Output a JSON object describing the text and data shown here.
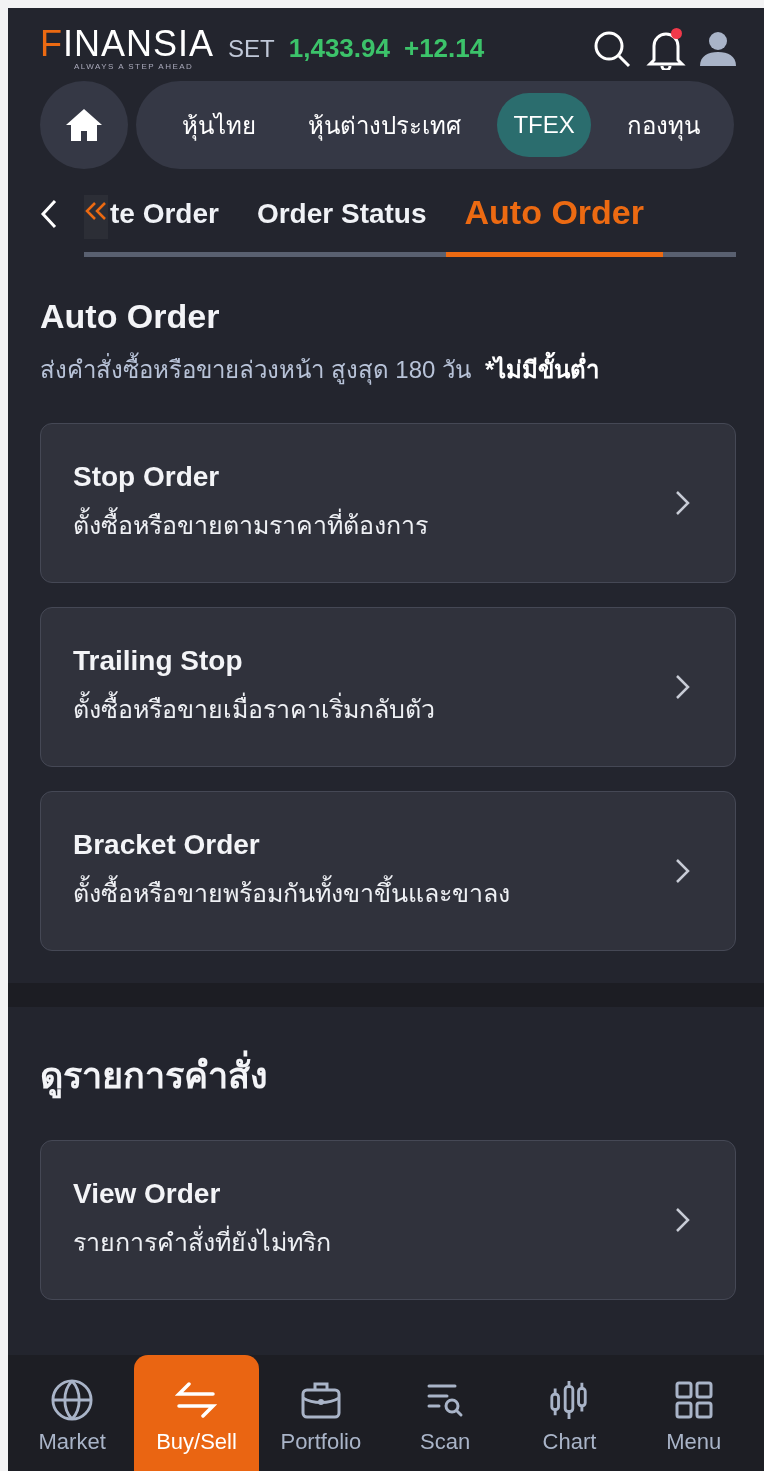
{
  "header": {
    "logo": "FINANSIA",
    "tagline": "ALWAYS A STEP AHEAD",
    "index_name": "SET",
    "index_value": "1,433.94",
    "index_change": "+12.14",
    "notification_unread": true
  },
  "market_tabs": [
    {
      "label": "หุ้นไทย",
      "selected": false
    },
    {
      "label": "หุ้นต่างประเทศ",
      "selected": false
    },
    {
      "label": "TFEX",
      "selected": true
    },
    {
      "label": "กองทุน",
      "selected": false
    }
  ],
  "order_tabs": [
    {
      "label": "te Order",
      "selected": false
    },
    {
      "label": "Order Status",
      "selected": false
    },
    {
      "label": "Auto Order",
      "selected": true
    }
  ],
  "auto_order": {
    "title": "Auto Order",
    "subtitle": "ส่งคำสั่งซื้อหรือขายล่วงหน้า สูงสุด 180 วัน",
    "note": "*ไม่มีขั้นต่ำ",
    "items": [
      {
        "title": "Stop Order",
        "description": "ตั้งซื้อหรือขายตามราคาที่ต้องการ"
      },
      {
        "title": "Trailing Stop",
        "description": "ตั้งซื้อหรือขายเมื่อราคาเริ่มกลับตัว"
      },
      {
        "title": "Bracket Order",
        "description": "ตั้งซื้อหรือขายพร้อมกันทั้งขาขึ้นและขาลง"
      }
    ]
  },
  "view_orders": {
    "title": "ดูรายการคำสั่ง",
    "items": [
      {
        "title": "View Order",
        "description": "รายการคำสั่งที่ยังไม่ทริก"
      }
    ]
  },
  "bottom_nav": [
    {
      "kind": "globe",
      "label": "Market",
      "selected": false
    },
    {
      "kind": "swap",
      "label": "Buy/Sell",
      "selected": true
    },
    {
      "kind": "briefcase",
      "label": "Portfolio",
      "selected": false
    },
    {
      "kind": "scan",
      "label": "Scan",
      "selected": false
    },
    {
      "kind": "candles",
      "label": "Chart",
      "selected": false
    },
    {
      "kind": "grid",
      "label": "Menu",
      "selected": false
    }
  ]
}
